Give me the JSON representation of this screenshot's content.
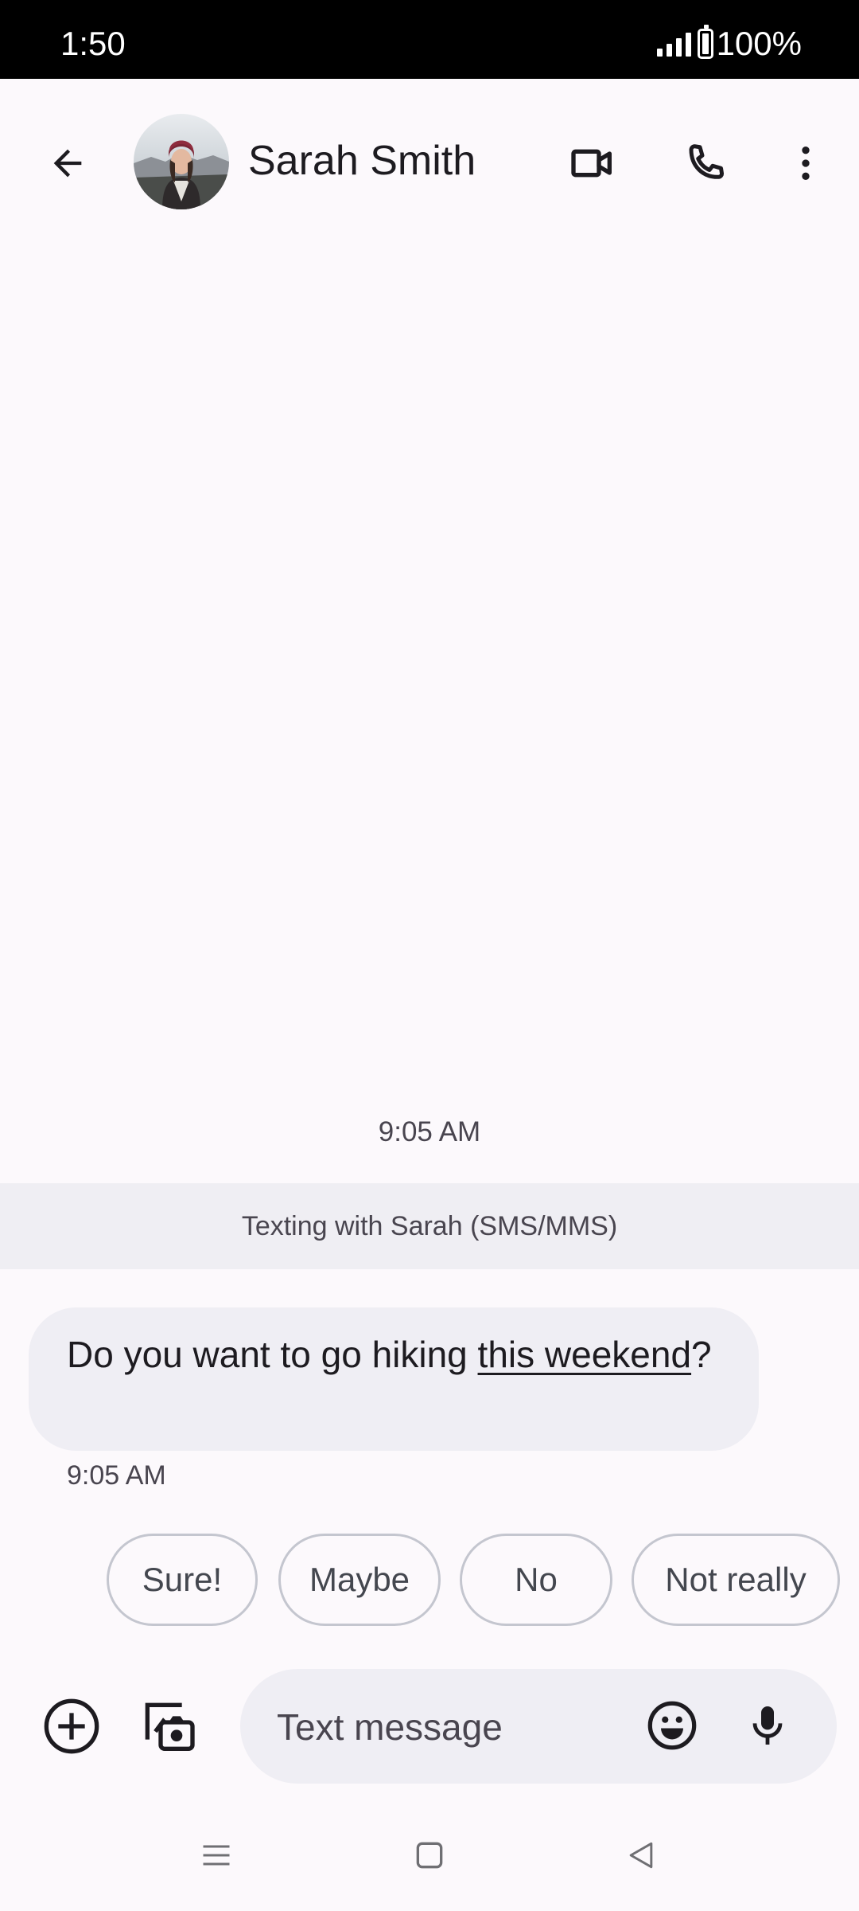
{
  "status_bar": {
    "time": "1:50",
    "battery": "100%",
    "icons": [
      "signal-icon",
      "battery-icon"
    ]
  },
  "header": {
    "contact_name": "Sarah Smith",
    "icons": [
      "back-arrow-icon",
      "contact-avatar",
      "video-call-icon",
      "phone-icon",
      "more-vert-icon"
    ]
  },
  "conversation": {
    "date_label": "9:05 AM",
    "banner": "Texting with Sarah (SMS/MMS)",
    "messages": [
      {
        "direction": "incoming",
        "text_before": "Do you want to go hiking ",
        "link_text": "this weekend",
        "text_after": "?",
        "time": "9:05 AM"
      }
    ]
  },
  "smart_replies": [
    "Sure!",
    "Maybe",
    "No",
    "Not really"
  ],
  "compose": {
    "placeholder": "Text message",
    "icons": [
      "add-circle-icon",
      "gallery-camera-icon",
      "emoji-icon",
      "mic-icon"
    ]
  },
  "nav_bar": {
    "icons": [
      "recents-icon",
      "home-icon",
      "back-triangle-icon"
    ]
  },
  "colors": {
    "background": "#fcf9fc",
    "bubble": "#efeef4",
    "banner": "#efeef3",
    "chip_border": "#c4c6cf"
  }
}
